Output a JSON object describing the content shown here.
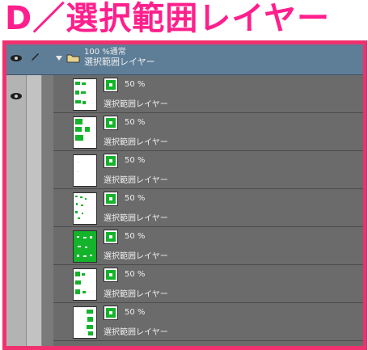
{
  "page_title": "D／選択範囲レイヤー",
  "folder": {
    "opacity_blend": "100 %通常",
    "name": "選択範囲レイヤー"
  },
  "layers": [
    {
      "opacity": "50 %",
      "name": "選択範囲レイヤー"
    },
    {
      "opacity": "50 %",
      "name": "選択範囲レイヤー"
    },
    {
      "opacity": "50 %",
      "name": "選択範囲レイヤー"
    },
    {
      "opacity": "50 %",
      "name": "選択範囲レイヤー"
    },
    {
      "opacity": "50 %",
      "name": "選択範囲レイヤー"
    },
    {
      "opacity": "50 %",
      "name": "選択範囲レイヤー"
    },
    {
      "opacity": "50 %",
      "name": "選択範囲レイヤー"
    }
  ],
  "colors": {
    "title": "#ff1f8c",
    "frame_border": "#f0316f",
    "folder_row": "#5e7e98",
    "selection_green": "#13b32a"
  },
  "icons": [
    "eye-icon",
    "pen-icon",
    "chevron-down-icon",
    "folder-icon",
    "selection-layer-icon"
  ]
}
